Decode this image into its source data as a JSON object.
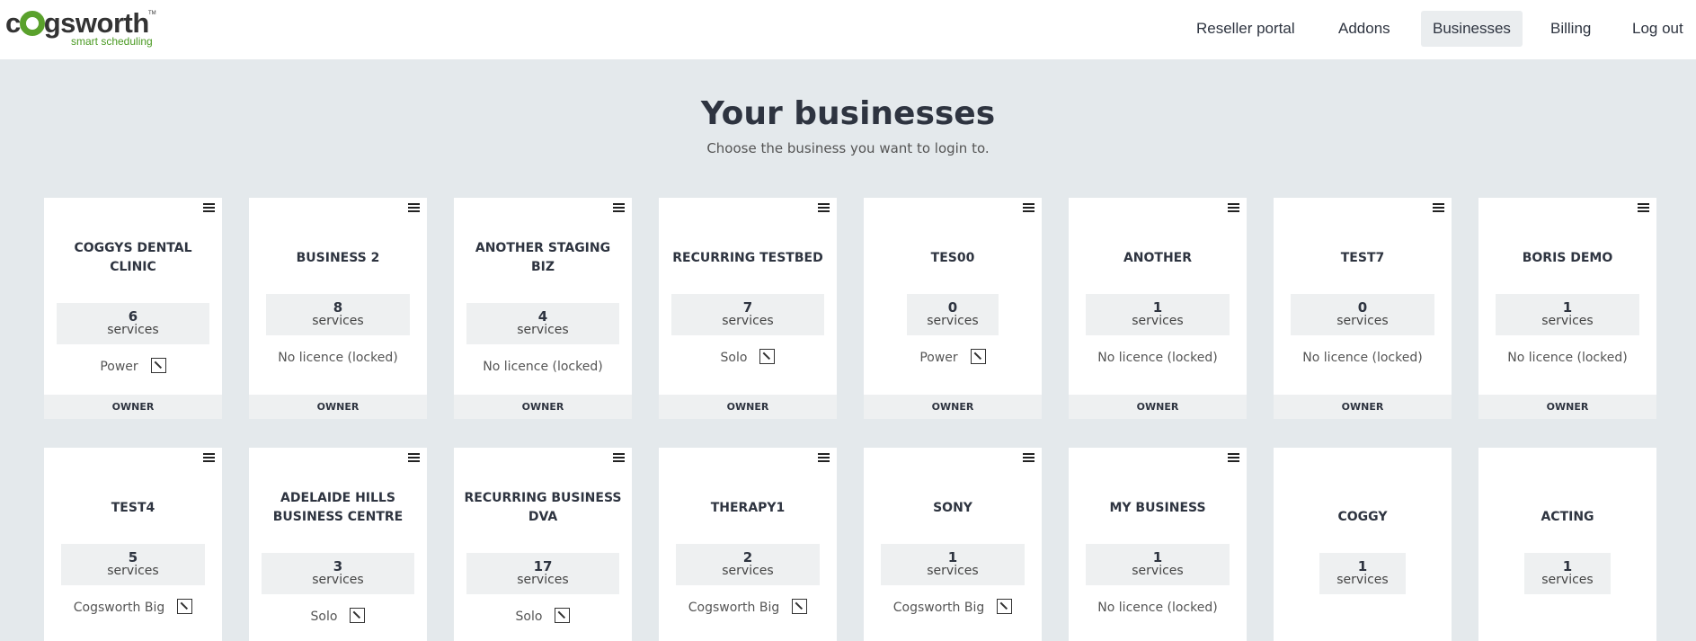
{
  "brand": {
    "name_prefix": "c",
    "name_suffix": "gsworth",
    "tm": "TM",
    "tagline": "smart scheduling",
    "accent": "#5aa12c"
  },
  "nav": {
    "reseller": "Reseller portal",
    "addons": "Addons",
    "businesses": "Businesses",
    "billing": "Billing",
    "logout": "Log out"
  },
  "page": {
    "title": "Your businesses",
    "subtitle": "Choose the business you want to login to."
  },
  "businesses": [
    {
      "name": "COGGYS DENTAL CLINIC",
      "services": "6",
      "services_label": "services",
      "licence": "Power",
      "role": "OWNER"
    },
    {
      "name": "BUSINESS 2",
      "services": "8",
      "services_label": "services",
      "licence": "No licence (locked)",
      "role": "OWNER"
    },
    {
      "name": "ANOTHER STAGING BIZ",
      "services": "4",
      "services_label": "services",
      "licence": "No licence (locked)",
      "role": "OWNER"
    },
    {
      "name": "RECURRING TESTBED",
      "services": "7",
      "services_label": "services",
      "licence": "Solo",
      "role": "OWNER"
    },
    {
      "name": "TES00",
      "services": "0",
      "services_label": "services",
      "licence": "Power",
      "role": "OWNER"
    },
    {
      "name": "ANOTHER",
      "services": "1",
      "services_label": "services",
      "licence": "No licence (locked)",
      "role": "OWNER"
    },
    {
      "name": "TEST7",
      "services": "0",
      "services_label": "services",
      "licence": "No licence (locked)",
      "role": "OWNER"
    },
    {
      "name": "BORIS DEMO",
      "services": "1",
      "services_label": "services",
      "licence": "No licence (locked)",
      "role": "OWNER"
    },
    {
      "name": "TEST4",
      "services": "5",
      "services_label": "services",
      "licence": "Cogsworth Big"
    },
    {
      "name": "ADELAIDE HILLS BUSINESS CENTRE",
      "services": "3",
      "services_label": "services",
      "licence": "Solo"
    },
    {
      "name": "RECURRING BUSINESS DVA",
      "services": "17",
      "services_label": "services",
      "licence": "Solo"
    },
    {
      "name": "THERAPY1",
      "services": "2",
      "services_label": "services",
      "licence": "Cogsworth Big"
    },
    {
      "name": "SONY",
      "services": "1",
      "services_label": "services",
      "licence": "Cogsworth Big"
    },
    {
      "name": "MY BUSINESS",
      "services": "1",
      "services_label": "services",
      "licence": "No licence (locked)"
    },
    {
      "name": "COGGY",
      "services": "1",
      "services_label": "services"
    },
    {
      "name": "ACTING",
      "services": "1",
      "services_label": "services"
    }
  ]
}
